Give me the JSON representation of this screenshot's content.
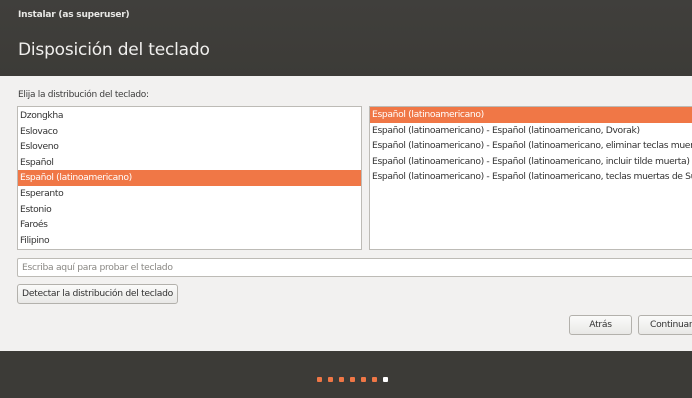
{
  "window": {
    "title": "Instalar (as superuser)",
    "page_title": "Disposición del teclado"
  },
  "prompt": "Elija la distribución del teclado:",
  "layouts": [
    "Dzongkha",
    "Eslovaco",
    "Esloveno",
    "Español",
    "Español (latinoamericano)",
    "Esperanto",
    "Estonio",
    "Faroés",
    "Filipino"
  ],
  "selected_layout_index": 4,
  "variants": [
    "Español (latinoamericano)",
    "Español (latinoamericano) - Español (latinoamericano, Dvorak)",
    "Español (latinoamericano) - Español (latinoamericano, eliminar teclas muertas)",
    "Español (latinoamericano) - Español (latinoamericano, incluir tilde muerta)",
    "Español (latinoamericano) - Español (latinoamericano, teclas muertas de Sun)"
  ],
  "selected_variant_index": 0,
  "test_input": {
    "placeholder": "Escriba aquí para probar el teclado",
    "value": ""
  },
  "buttons": {
    "detect": "Detectar la distribución del teclado",
    "back": "Atrás",
    "continue": "Continuar"
  },
  "progress": {
    "total_steps": 7,
    "completed_steps": 6,
    "active_color": "#f07746",
    "inactive_color": "#ffffff"
  },
  "colors": {
    "accent": "#f07746",
    "header_bg": "#3c3b37",
    "body_bg": "#f2f1f0"
  }
}
